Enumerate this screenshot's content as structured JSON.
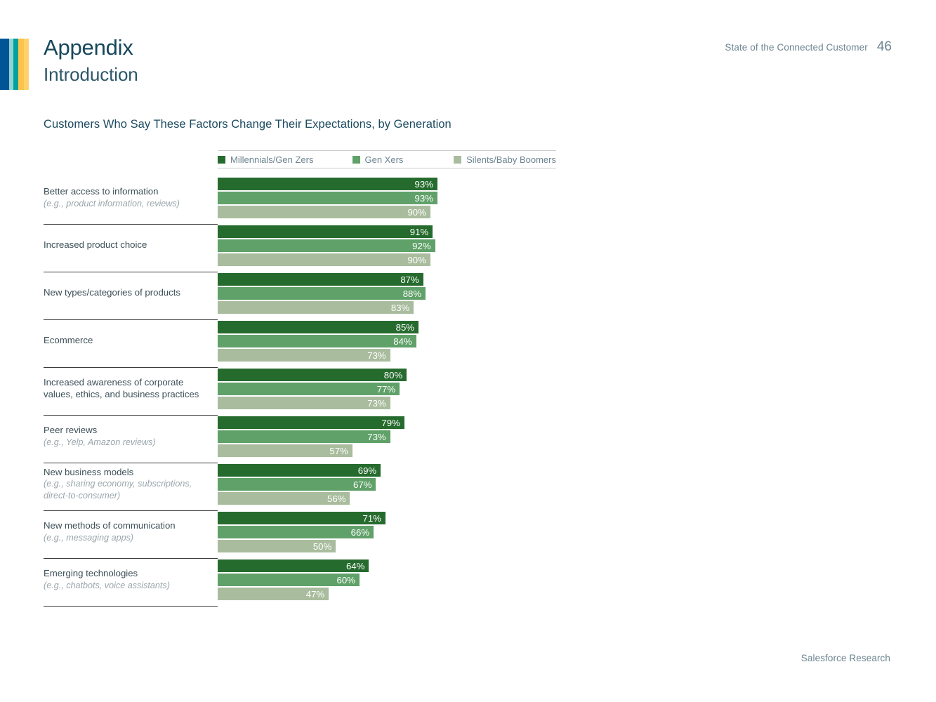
{
  "header": {
    "title": "Appendix",
    "subtitle": "Introduction",
    "doc_name": "State of the Connected Customer",
    "page_number": "46",
    "stripe_colors": [
      "#005596",
      "#8fd4d0",
      "#00a1a0",
      "#fbc34b",
      "#fdd26e"
    ],
    "title_color": "#16475c"
  },
  "footer": {
    "credit": "Salesforce Research"
  },
  "chart_data": {
    "type": "bar",
    "orientation": "horizontal",
    "title": "Customers Who Say These Factors Change Their Expectations, by Generation",
    "xlabel": "",
    "ylabel": "",
    "xlim": [
      0,
      100
    ],
    "grid": false,
    "legend_position": "top",
    "value_suffix": "%",
    "series": [
      {
        "name": "Millennials/Gen Zers",
        "color": "#266b2e",
        "values": [
          93,
          91,
          87,
          85,
          80,
          79,
          69,
          71,
          64
        ]
      },
      {
        "name": "Gen Xers",
        "color": "#60a169",
        "values": [
          93,
          92,
          88,
          84,
          77,
          73,
          67,
          66,
          60
        ]
      },
      {
        "name": "Silents/Baby Boomers",
        "color": "#a9bd9e",
        "values": [
          90,
          90,
          83,
          73,
          73,
          57,
          56,
          50,
          47
        ]
      }
    ],
    "categories": [
      {
        "label": "Better access to information",
        "sublabel": "(e.g., product information, reviews)"
      },
      {
        "label": "Increased product choice",
        "sublabel": ""
      },
      {
        "label": "New types/categories of products",
        "sublabel": ""
      },
      {
        "label": "Ecommerce",
        "sublabel": ""
      },
      {
        "label": "Increased awareness of corporate values, ethics, and business practices",
        "sublabel": ""
      },
      {
        "label": "Peer reviews",
        "sublabel": "(e.g., Yelp, Amazon reviews)"
      },
      {
        "label": "New business models",
        "sublabel": "(e.g., sharing economy, subscriptions, direct-to-consumer)"
      },
      {
        "label": "New methods of communication",
        "sublabel": "(e.g., messaging apps)"
      },
      {
        "label": "Emerging technologies",
        "sublabel": "(e.g., chatbots, voice assistants)"
      }
    ],
    "rows": [
      {
        "label": "Better access to information",
        "sublabel": "(e.g., product information, reviews)",
        "bars": [
          {
            "series": "Millennials/Gen Zers",
            "value": 93,
            "text": "93%"
          },
          {
            "series": "Gen Xers",
            "value": 93,
            "text": "93%"
          },
          {
            "series": "Silents/Baby Boomers",
            "value": 90,
            "text": "90%"
          }
        ]
      },
      {
        "label": "Increased product choice",
        "sublabel": "",
        "bars": [
          {
            "series": "Millennials/Gen Zers",
            "value": 91,
            "text": "91%"
          },
          {
            "series": "Gen Xers",
            "value": 92,
            "text": "92%"
          },
          {
            "series": "Silents/Baby Boomers",
            "value": 90,
            "text": "90%"
          }
        ]
      },
      {
        "label": "New types/categories of products",
        "sublabel": "",
        "bars": [
          {
            "series": "Millennials/Gen Zers",
            "value": 87,
            "text": "87%"
          },
          {
            "series": "Gen Xers",
            "value": 88,
            "text": "88%"
          },
          {
            "series": "Silents/Baby Boomers",
            "value": 83,
            "text": "83%"
          }
        ]
      },
      {
        "label": "Ecommerce",
        "sublabel": "",
        "bars": [
          {
            "series": "Millennials/Gen Zers",
            "value": 85,
            "text": "85%"
          },
          {
            "series": "Gen Xers",
            "value": 84,
            "text": "84%"
          },
          {
            "series": "Silents/Baby Boomers",
            "value": 73,
            "text": "73%"
          }
        ]
      },
      {
        "label": "Increased awareness of corporate values, ethics, and business practices",
        "sublabel": "",
        "bars": [
          {
            "series": "Millennials/Gen Zers",
            "value": 80,
            "text": "80%"
          },
          {
            "series": "Gen Xers",
            "value": 77,
            "text": "77%"
          },
          {
            "series": "Silents/Baby Boomers",
            "value": 73,
            "text": "73%"
          }
        ]
      },
      {
        "label": "Peer reviews",
        "sublabel": "(e.g., Yelp, Amazon reviews)",
        "bars": [
          {
            "series": "Millennials/Gen Zers",
            "value": 79,
            "text": "79%"
          },
          {
            "series": "Gen Xers",
            "value": 73,
            "text": "73%"
          },
          {
            "series": "Silents/Baby Boomers",
            "value": 57,
            "text": "57%"
          }
        ]
      },
      {
        "label": "New business models",
        "sublabel": "(e.g., sharing economy, subscriptions, direct-to-consumer)",
        "bars": [
          {
            "series": "Millennials/Gen Zers",
            "value": 69,
            "text": "69%"
          },
          {
            "series": "Gen Xers",
            "value": 67,
            "text": "67%"
          },
          {
            "series": "Silents/Baby Boomers",
            "value": 56,
            "text": "56%"
          }
        ]
      },
      {
        "label": "New methods of communication",
        "sublabel": "(e.g., messaging apps)",
        "bars": [
          {
            "series": "Millennials/Gen Zers",
            "value": 71,
            "text": "71%"
          },
          {
            "series": "Gen Xers",
            "value": 66,
            "text": "66%"
          },
          {
            "series": "Silents/Baby Boomers",
            "value": 50,
            "text": "50%"
          }
        ]
      },
      {
        "label": "Emerging technologies",
        "sublabel": "(e.g., chatbots, voice assistants)",
        "bars": [
          {
            "series": "Millennials/Gen Zers",
            "value": 64,
            "text": "64%"
          },
          {
            "series": "Gen Xers",
            "value": 60,
            "text": "60%"
          },
          {
            "series": "Silents/Baby Boomers",
            "value": 47,
            "text": "47%"
          }
        ]
      }
    ]
  }
}
